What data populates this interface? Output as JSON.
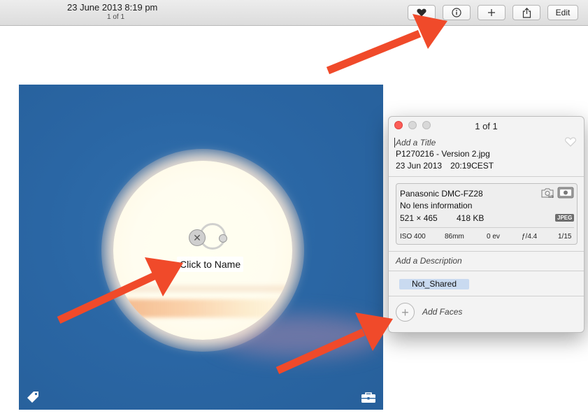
{
  "toolbar": {
    "date": "23 June 2013 8:19 pm",
    "count": "1 of 1",
    "edit_label": "Edit",
    "buttons": [
      "heart-icon",
      "info-icon",
      "plus-icon",
      "share-icon"
    ]
  },
  "photo": {
    "face_label": "Click to Name",
    "icons": [
      "tag-icon",
      "toolbox-icon"
    ]
  },
  "info_panel": {
    "title": "1 of 1",
    "add_title_placeholder": "Add a Title",
    "filename": "P1270216 - Version 2.jpg",
    "date": "23 Jun 2013",
    "time": "20:19CEST",
    "camera": {
      "model": "Panasonic DMC-FZ28",
      "lens": "No lens information",
      "dimensions": "521 × 465",
      "file_size": "418 KB",
      "format": "JPEG",
      "iso": "ISO 400",
      "focal_length": "86mm",
      "exposure_bias": "0 ev",
      "aperture": "ƒ/4.4",
      "shutter": "1/15"
    },
    "description_placeholder": "Add a Description",
    "keyword": "Not_Shared",
    "add_faces_label": "Add Faces"
  },
  "colors": {
    "annotation_arrow": "#f04a2a",
    "close": "#fc5d57",
    "keyword_tag": "#c9daf0",
    "sky": "#2a66a4"
  }
}
